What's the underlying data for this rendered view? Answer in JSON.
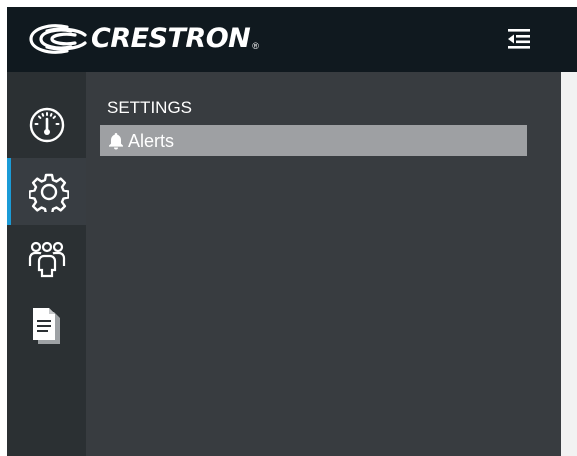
{
  "header": {
    "brand": "CRESTRON",
    "brand_mark": "®"
  },
  "sidebar": {
    "items": [
      {
        "icon": "dashboard-gauge-icon",
        "active": false
      },
      {
        "icon": "gear-icon",
        "active": true
      },
      {
        "icon": "users-icon",
        "active": false
      },
      {
        "icon": "document-icon",
        "active": false
      }
    ]
  },
  "panel": {
    "title": "SETTINGS",
    "items": [
      {
        "icon": "bell-icon",
        "label": "Alerts"
      }
    ]
  },
  "colors": {
    "topbar": "#10191f",
    "sidebar": "#2b3033",
    "panel": "#383c40",
    "active_indicator": "#1b9bd7",
    "selected_item": "#9ea0a3"
  }
}
